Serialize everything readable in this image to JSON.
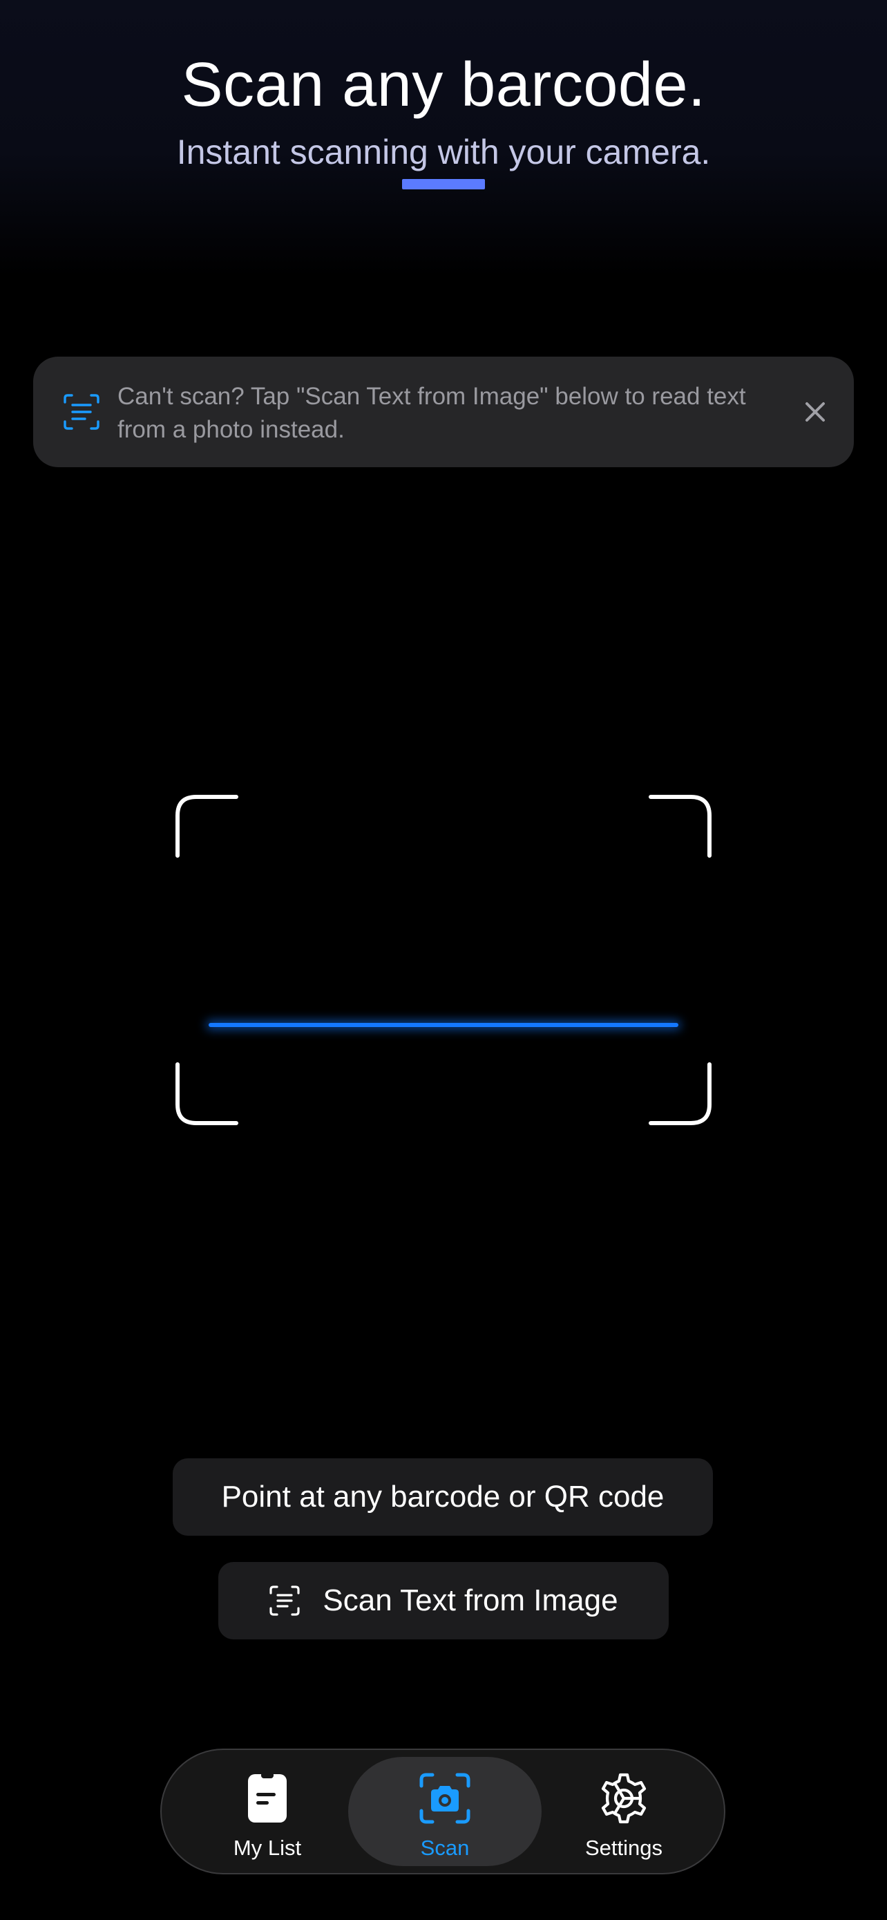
{
  "header": {
    "title": "Scan any barcode.",
    "subtitle": "Instant scanning with your camera."
  },
  "hint_banner": {
    "icon": "scan-text-icon",
    "text": "Can't scan? Tap \"Scan Text from Image\" below to read text from a photo instead.",
    "close_icon": "close-icon"
  },
  "scanner": {
    "instruction": "Point at any barcode or QR code",
    "scan_text_button": {
      "icon": "scan-text-icon",
      "label": "Scan Text from Image"
    }
  },
  "tab_bar": {
    "tabs": [
      {
        "label": "My List",
        "icon": "clipboard-icon",
        "active": false
      },
      {
        "label": "Scan",
        "icon": "camera-scan-icon",
        "active": true
      },
      {
        "label": "Settings",
        "icon": "gear-icon",
        "active": false
      }
    ]
  },
  "colors": {
    "accent": "#1a9bff",
    "underline_accent": "#5b7bff",
    "scan_line": "#1478ff",
    "banner_bg": "#262628",
    "pill_bg": "#1c1c1e"
  }
}
